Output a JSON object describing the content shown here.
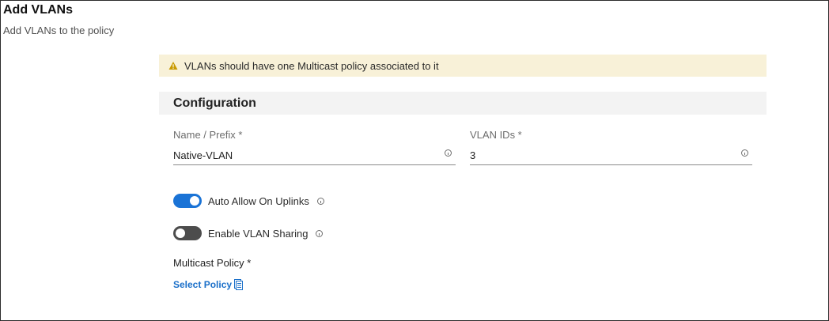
{
  "header": {
    "title": "Add VLANs",
    "subtitle": "Add VLANs to the policy"
  },
  "warning": {
    "icon": "warning-triangle-icon",
    "text": "VLANs should have one Multicast policy associated to it",
    "background_color": "#f8f1d8",
    "icon_color": "#c99a00"
  },
  "configuration": {
    "title": "Configuration",
    "name_field": {
      "label": "Name / Prefix *",
      "value": "Native-VLAN"
    },
    "vlan_ids_field": {
      "label": "VLAN IDs *",
      "value": "3"
    },
    "toggles": [
      {
        "label": "Auto Allow On Uplinks",
        "state": "on"
      },
      {
        "label": "Enable VLAN Sharing",
        "state": "off"
      }
    ],
    "multicast_policy": {
      "label": "Multicast Policy *",
      "link_label": "Select Policy"
    }
  },
  "colors": {
    "accent": "#1a73d6",
    "link": "#1a6fc9",
    "toggle_off": "#4c4c4c"
  }
}
